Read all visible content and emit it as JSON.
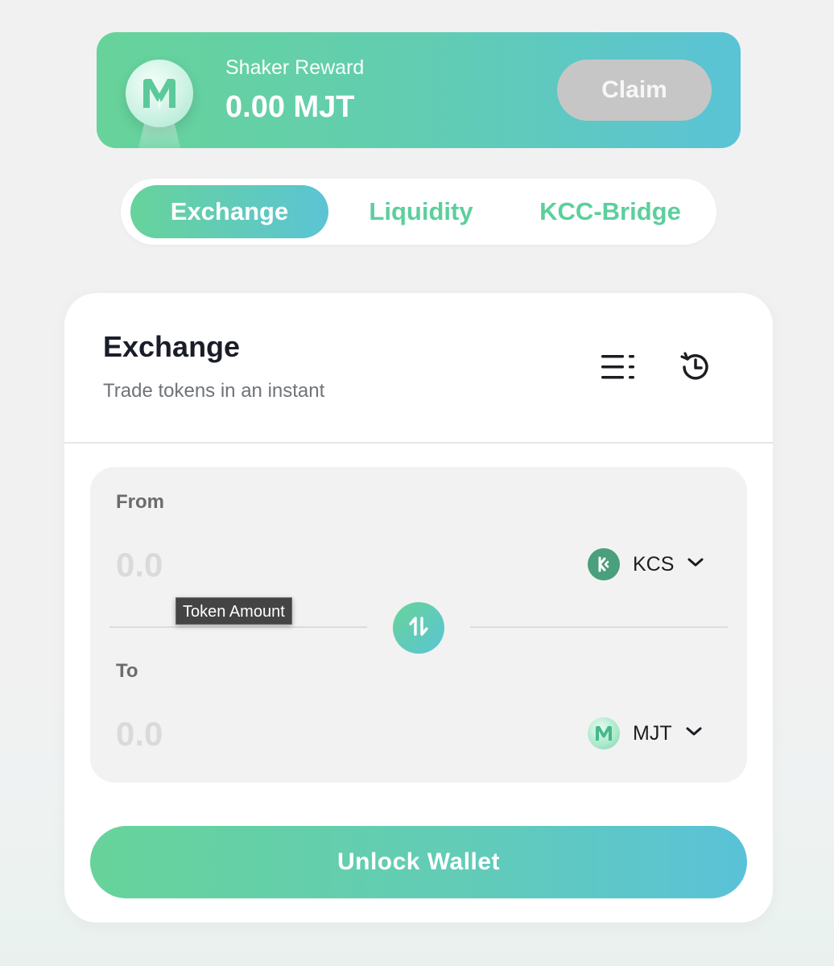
{
  "reward": {
    "title": "Shaker Reward",
    "amount": "0.00 MJT",
    "claim_label": "Claim",
    "logo_icon": "mjt-logo-icon"
  },
  "tabs": [
    {
      "label": "Exchange",
      "active": true
    },
    {
      "label": "Liquidity",
      "active": false
    },
    {
      "label": "KCC-Bridge",
      "active": false
    }
  ],
  "exchange": {
    "title": "Exchange",
    "subtitle": "Trade tokens in an instant",
    "settings_icon": "settings-list-icon",
    "history_icon": "history-icon",
    "from": {
      "label": "From",
      "placeholder": "0.0",
      "token": "KCS",
      "token_icon": "kcs-token-icon"
    },
    "to": {
      "label": "To",
      "placeholder": "0.0",
      "token": "MJT",
      "token_icon": "mjt-token-icon"
    },
    "tooltip": "Token Amount",
    "swap_icon": "swap-arrows-icon",
    "unlock_label": "Unlock Wallet"
  },
  "colors": {
    "accent_green": "#67d39a",
    "accent_blue": "#5ac3d6",
    "tab_text": "#5ccf9c",
    "claim_disabled": "#c6c6c6"
  }
}
